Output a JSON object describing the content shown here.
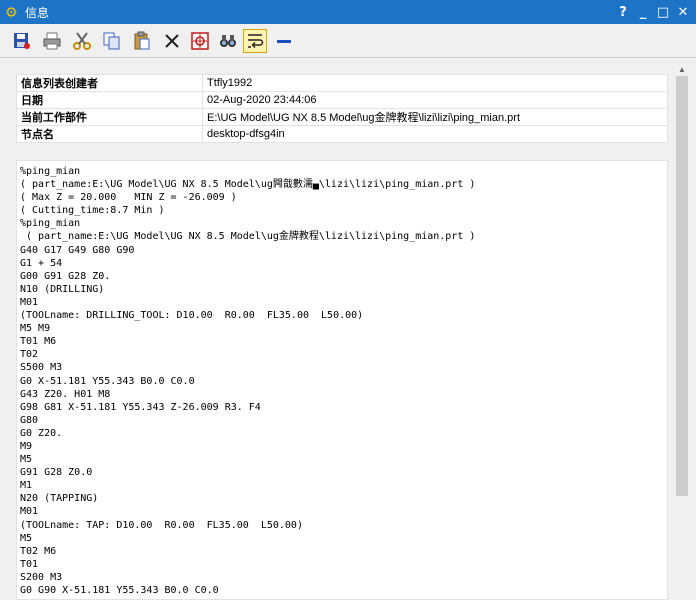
{
  "window": {
    "title": "信息",
    "controls": {
      "help": "?",
      "minimize": "_",
      "maximize": "□",
      "close": "✕"
    }
  },
  "toolbar": {
    "buttons": [
      {
        "name": "save-icon"
      },
      {
        "name": "print-icon"
      },
      {
        "name": "cut-icon"
      },
      {
        "name": "copy-icon"
      },
      {
        "name": "paste-icon"
      },
      {
        "name": "delete-icon"
      },
      {
        "name": "crosshair-icon"
      },
      {
        "name": "binoculars-icon"
      },
      {
        "name": "word-wrap-icon",
        "active": true
      },
      {
        "name": "minus-icon"
      }
    ]
  },
  "info": {
    "rows": [
      {
        "key": "信息列表创建者",
        "value": "Ttfly1992"
      },
      {
        "key": "日期",
        "value": "02-Aug-2020 23:44:06"
      },
      {
        "key": "当前工作部件",
        "value": "E:\\UG Model\\UG NX 8.5 Model\\ug金牌教程\\lizi\\lizi\\ping_mian.prt"
      },
      {
        "key": "节点名",
        "value": "desktop-dfsg4in"
      }
    ]
  },
  "output": {
    "lines": [
      "%ping_mian",
      "( part_name:E:\\UG Model\\UG NX 8.5 Model\\ug闁戠數濡▄\\lizi\\lizi\\ping_mian.prt )",
      "( Max Z = 20.000   MIN Z = -26.009 )",
      "( Cutting_time:8.7 Min )",
      "%ping_mian",
      " ( part_name:E:\\UG Model\\UG NX 8.5 Model\\ug金牌教程\\lizi\\lizi\\ping_mian.prt )",
      "G40 G17 G49 G80 G90",
      "G1 + 54",
      "G00 G91 G28 Z0.",
      "N10 (DRILLING)",
      "M01",
      "(TOOLname: DRILLING_TOOL: D10.00  R0.00  FL35.00  L50.00)",
      "M5 M9",
      "T01 M6",
      "T02",
      "S500 M3",
      "G0 X-51.181 Y55.343 B0.0 C0.0",
      "G43 Z20. H01 M8",
      "G98 G81 X-51.181 Y55.343 Z-26.009 R3. F4",
      "G80",
      "G0 Z20.",
      "M9",
      "M5",
      "G91 G28 Z0.0",
      "M1",
      "N20 (TAPPING)",
      "M01",
      "(TOOLname: TAP: D10.00  R0.00  FL35.00  L50.00)",
      "M5",
      "T02 M6",
      "T01",
      "S200 M3",
      "G0 G90 X-51.181 Y55.343 B0.0 C0.0"
    ]
  }
}
